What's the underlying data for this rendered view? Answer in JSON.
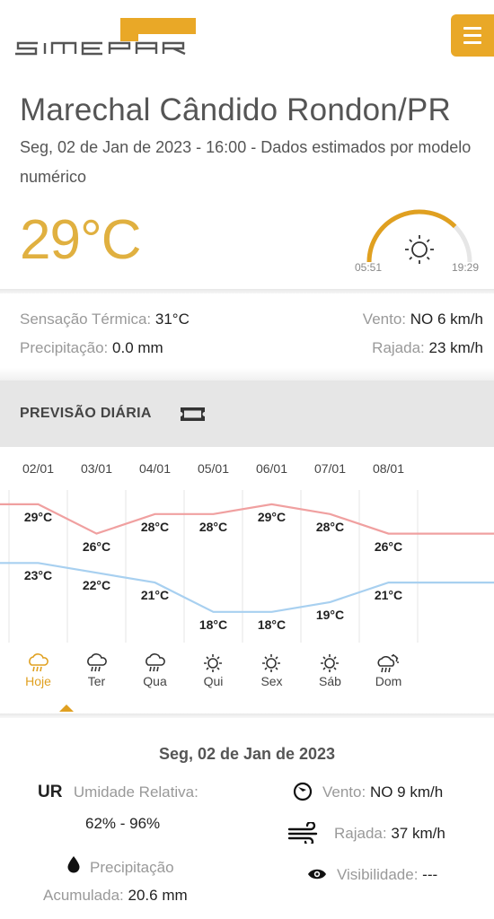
{
  "header": {
    "logo_text": "simepar",
    "menu_icon": "hamburger-menu-icon"
  },
  "location": {
    "city": "Marechal Cândido Rondon/PR",
    "dateline": "Seg, 02 de Jan de 2023 - 16:00 - Dados estimados por modelo numérico"
  },
  "current": {
    "temperature": "29°C",
    "sunrise": "05:51",
    "sunset": "19:29",
    "sun_progress": 0.75,
    "icon": "sun-icon"
  },
  "conditions": {
    "sensacao_label": "Sensação Térmica:",
    "sensacao_value": "31°C",
    "precip_label": "Precipitação:",
    "precip_value": "0.0 mm",
    "vento_label": "Vento:",
    "vento_value": "NO 6 km/h",
    "rajada_label": "Rajada:",
    "rajada_value": "23 km/h"
  },
  "daily": {
    "title": "PREVISÃO DIÁRIA",
    "days": [
      {
        "date": "02/01",
        "max": "29°C",
        "min": "23°C",
        "name": "Hoje",
        "icon": "rain-cloud-icon",
        "active": true
      },
      {
        "date": "03/01",
        "max": "26°C",
        "min": "22°C",
        "name": "Ter",
        "icon": "rain-cloud-icon",
        "active": false
      },
      {
        "date": "04/01",
        "max": "28°C",
        "min": "21°C",
        "name": "Qua",
        "icon": "rain-cloud-icon",
        "active": false
      },
      {
        "date": "05/01",
        "max": "28°C",
        "min": "18°C",
        "name": "Qui",
        "icon": "sun-icon",
        "active": false
      },
      {
        "date": "06/01",
        "max": "29°C",
        "min": "18°C",
        "name": "Sex",
        "icon": "sun-icon",
        "active": false
      },
      {
        "date": "07/01",
        "max": "28°C",
        "min": "19°C",
        "name": "Sáb",
        "icon": "sun-icon",
        "active": false
      },
      {
        "date": "08/01",
        "max": "26°C",
        "min": "21°C",
        "name": "Dom",
        "icon": "sun-rain-cloud-icon",
        "active": false
      }
    ]
  },
  "chart_data": {
    "type": "line",
    "categories": [
      "02/01",
      "03/01",
      "04/01",
      "05/01",
      "06/01",
      "07/01",
      "08/01"
    ],
    "series": [
      {
        "values": [
          29,
          26,
          28,
          28,
          29,
          28,
          26
        ],
        "color": "#f0a0a0"
      },
      {
        "values": [
          23,
          22,
          21,
          18,
          18,
          19,
          21
        ],
        "color": "#a8d0f0"
      }
    ]
  },
  "detail": {
    "date": "Seg, 02 de Jan de 2023",
    "ur_tag": "UR",
    "ur_label": "Umidade Relativa:",
    "ur_value": "62% - 96%",
    "precip_label": "Precipitação",
    "acum_label": "Acumulada:",
    "acum_value": "20.6 mm",
    "vento_label": "Vento:",
    "vento_value": "NO 9 km/h",
    "rajada_label": "Rajada:",
    "rajada_value": "37 km/h",
    "visib_label": "Visibilidade:",
    "visib_value": "---"
  },
  "colors": {
    "accent": "#e9a827",
    "max_line": "#f0a0a0",
    "min_line": "#a8d0f0"
  }
}
